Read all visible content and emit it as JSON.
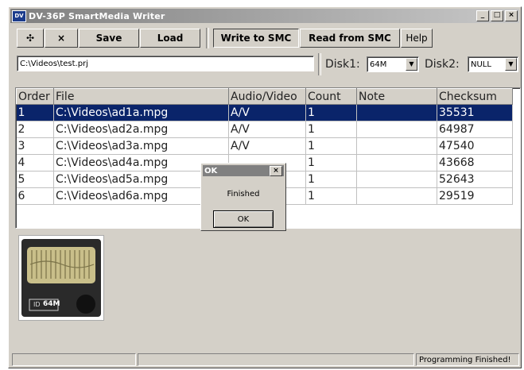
{
  "window": {
    "title": "DV-36P SmartMedia Writer",
    "app_icon": "DV",
    "controls": {
      "minimize": "_",
      "maximize": "□",
      "close": "×"
    }
  },
  "toolbar": {
    "add_label": "✣",
    "remove_label": "×",
    "save_label": "Save",
    "load_label": "Load",
    "write_label": "Write to SMC",
    "read_label": "Read from SMC",
    "help_label": "Help"
  },
  "project": {
    "path": "C:\\Videos\\test.prj",
    "disk1_label": "Disk1:",
    "disk1_value": "64M",
    "disk2_label": "Disk2:",
    "disk2_value": "NULL"
  },
  "table": {
    "headers": [
      "Order",
      "File",
      "Audio/Video",
      "Count",
      "Note",
      "Checksum"
    ],
    "rows": [
      [
        "1",
        "C:\\Videos\\ad1a.mpg",
        "A/V",
        "1",
        "",
        "35531"
      ],
      [
        "2",
        "C:\\Videos\\ad2a.mpg",
        "A/V",
        "1",
        "",
        "64987"
      ],
      [
        "3",
        "C:\\Videos\\ad3a.mpg",
        "A/V",
        "1",
        "",
        "47540"
      ],
      [
        "4",
        "C:\\Videos\\ad4a.mpg",
        "",
        "1",
        "",
        "43668"
      ],
      [
        "5",
        "C:\\Videos\\ad5a.mpg",
        "",
        "1",
        "",
        "52643"
      ],
      [
        "6",
        "C:\\Videos\\ad6a.mpg",
        "",
        "1",
        "",
        "29519"
      ]
    ],
    "selected_row": 0
  },
  "dialog": {
    "title": "OK",
    "close": "×",
    "message": "Finished",
    "ok_label": "OK"
  },
  "card": {
    "label_id": "ID",
    "capacity": "64M"
  },
  "status": {
    "pane1": "",
    "pane2": "",
    "pane3": "Programming Finished!"
  },
  "colors": {
    "face": "#d4d0c8",
    "selection": "#0a246a",
    "title_gradient_start": "#808080"
  }
}
